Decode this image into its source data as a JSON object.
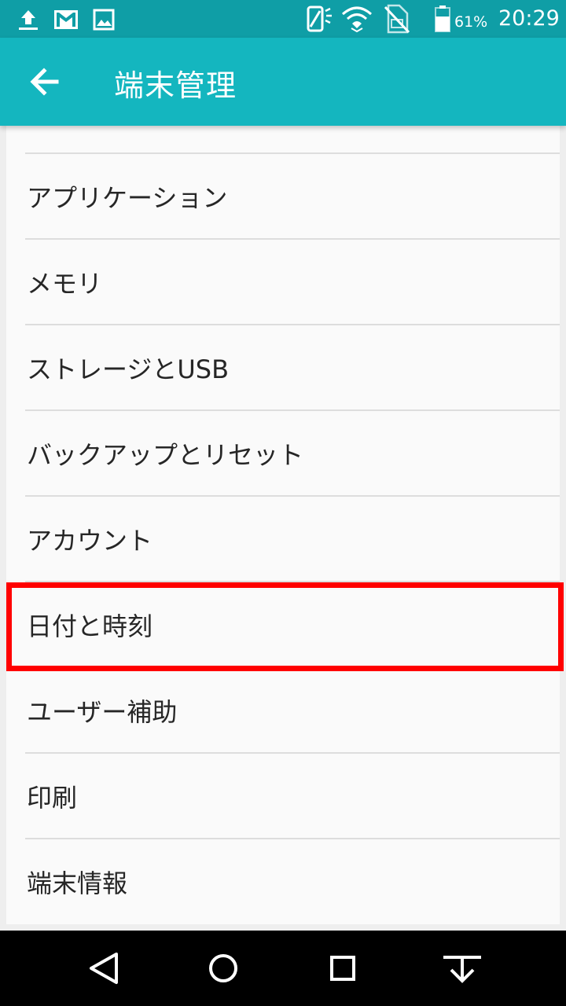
{
  "status_bar": {
    "battery_percent": "61%",
    "time": "20:29",
    "icons": [
      "upload-icon",
      "gmail-icon",
      "gallery-icon",
      "auto-rotate-icon",
      "wifi-icon",
      "no-sim-icon",
      "battery-icon"
    ]
  },
  "app_bar": {
    "title": "端末管理",
    "back_icon": "arrow-back-icon"
  },
  "list": {
    "items": [
      {
        "label": "アプリケーション"
      },
      {
        "label": "メモリ"
      },
      {
        "label": "ストレージとUSB"
      },
      {
        "label": "バックアップとリセット"
      },
      {
        "label": "アカウント"
      },
      {
        "label": "日付と時刻",
        "highlighted": true
      },
      {
        "label": "ユーザー補助"
      },
      {
        "label": "印刷"
      },
      {
        "label": "端末情報"
      }
    ]
  },
  "nav_bar": {
    "buttons": [
      "back-triangle-icon",
      "home-circle-icon",
      "recents-square-icon",
      "notification-pull-icon"
    ]
  },
  "colors": {
    "status_bar": "#0f9ea6",
    "app_bar": "#14b6bf",
    "highlight": "#ff0000"
  }
}
